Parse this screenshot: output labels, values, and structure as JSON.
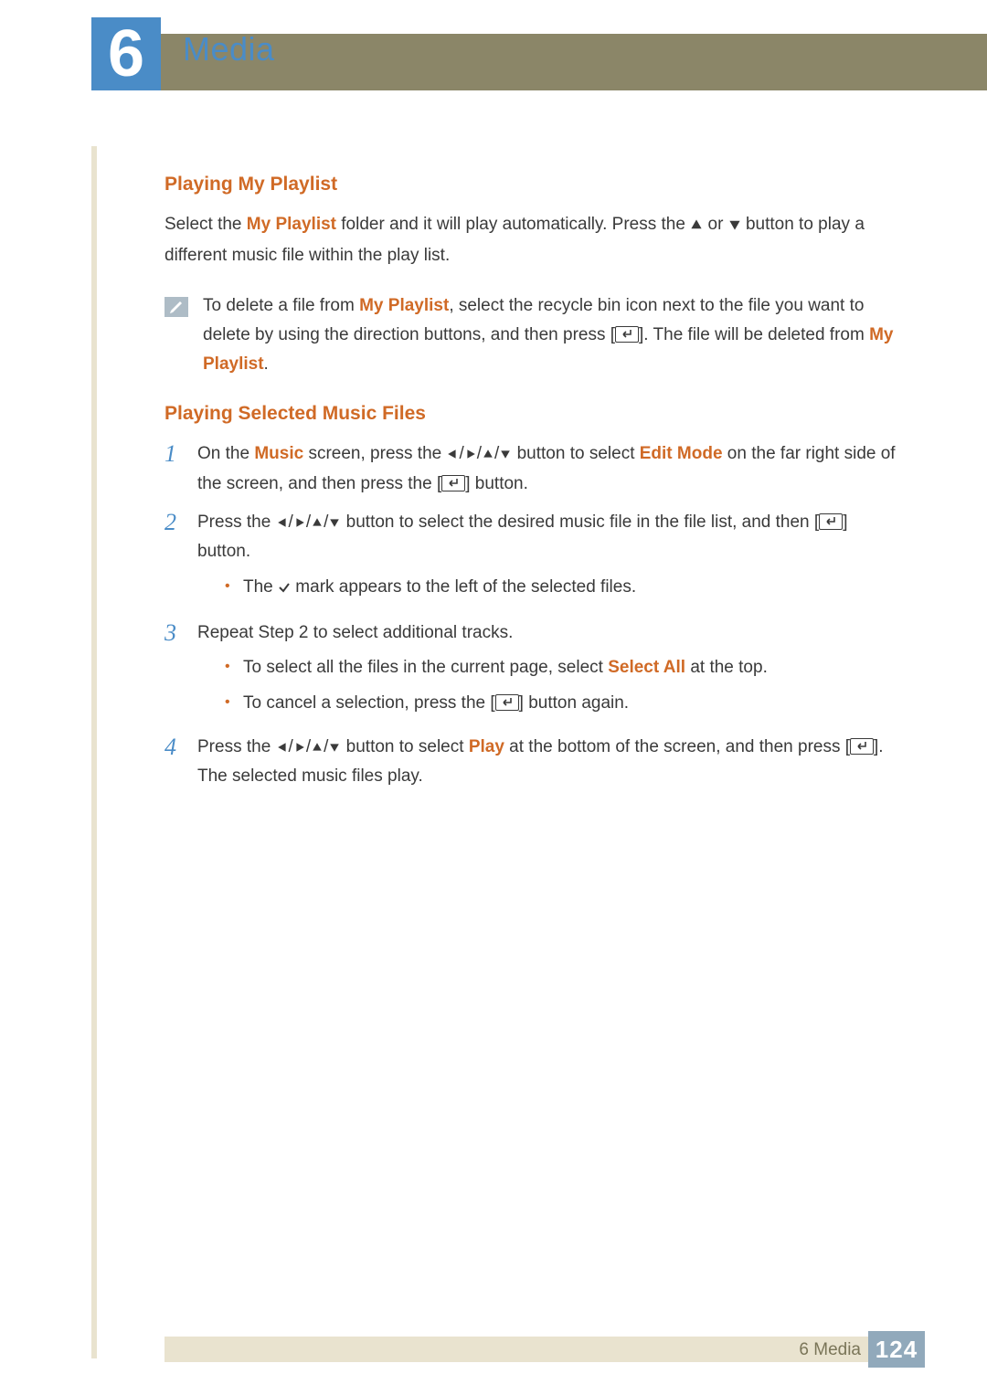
{
  "header": {
    "chapter_number": "6",
    "chapter_title": "Media"
  },
  "section1": {
    "title": "Playing My Playlist",
    "para_parts": {
      "a": "Select the ",
      "b": "My Playlist",
      "c": " folder and it will play automatically. Press the ",
      "d": " or ",
      "e": " button to play a different music file within the play list."
    },
    "note_parts": {
      "a": "To delete a file from ",
      "b": "My Playlist",
      "c": ", select the recycle bin icon next to the file you want to delete by using the direction buttons, and then press [",
      "d": "]. The file will be deleted from ",
      "e": "My Playlist",
      "f": "."
    }
  },
  "section2": {
    "title": "Playing Selected Music Files",
    "steps": {
      "s1_num": "1",
      "s1": {
        "a": "On the ",
        "b": "Music",
        "c": " screen, press the ",
        "d": " button to select ",
        "e": "Edit Mode",
        "f": " on the far right side of the screen, and then press the [",
        "g": "] button."
      },
      "s2_num": "2",
      "s2": {
        "a": "Press the ",
        "b": " button to select the desired music file in the file list, and then [",
        "c": "] button."
      },
      "s2_bullet1": {
        "a": "The ",
        "b": " mark appears to the left of the selected files."
      },
      "s3_num": "3",
      "s3_text": "Repeat Step 2 to select additional tracks.",
      "s3_bullet1": {
        "a": "To select all the files in the current page, select ",
        "b": "Select All",
        "c": " at the top."
      },
      "s3_bullet2": {
        "a": "To cancel a selection, press the [",
        "b": "] button again."
      },
      "s4_num": "4",
      "s4": {
        "a": "Press the ",
        "b": " button to select ",
        "c": "Play",
        "d": " at the bottom of the screen, and then press [",
        "e": "]. The selected music files play."
      }
    }
  },
  "footer": {
    "label": "6 Media",
    "page_number": "124"
  }
}
